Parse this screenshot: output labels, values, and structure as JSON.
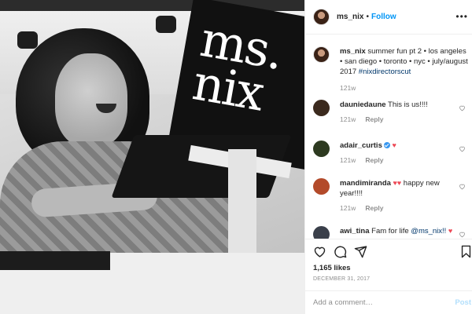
{
  "post": {
    "username": "ms_nix",
    "separator": "•",
    "follow_label": "Follow",
    "more_label": "•••",
    "photo_sign_text": "ms.\nnix"
  },
  "caption": {
    "username": "ms_nix",
    "text": " summer fun pt 2 • los angeles • san diego • toronto • nyc • july/august 2017 ",
    "hashtag": "#nixdirectorscut",
    "age": "121w"
  },
  "comments": [
    {
      "username": "dauniedaune",
      "text": " This is us!!!!",
      "age": "121w",
      "reply_label": "Reply",
      "avatar_color": "#3b2a1e"
    },
    {
      "username": "adair_curtis",
      "verified": true,
      "text": " ",
      "emoji": "♥",
      "age": "121w",
      "reply_label": "Reply",
      "avatar_color": "#2d3a20"
    },
    {
      "username": "mandimiranda",
      "emoji_prefix": " ♥♥",
      "text": " happy new year!!!!",
      "age": "121w",
      "reply_label": "Reply",
      "avatar_color": "#b34a2a"
    },
    {
      "username": "awi_tina",
      "text": " Fam for life ",
      "mention": "@ms_nix!!",
      "emoji": " ♥",
      "avatar_color": "#3a3f4a"
    }
  ],
  "likes": "1,165 likes",
  "date": "DECEMBER 31, 2017",
  "add_comment": {
    "placeholder": "Add a comment…",
    "post_label": "Post"
  },
  "colors": {
    "link_blue": "#0095f6",
    "text": "#262626",
    "muted": "#8e8e8e",
    "heart_red": "#ed4956"
  }
}
